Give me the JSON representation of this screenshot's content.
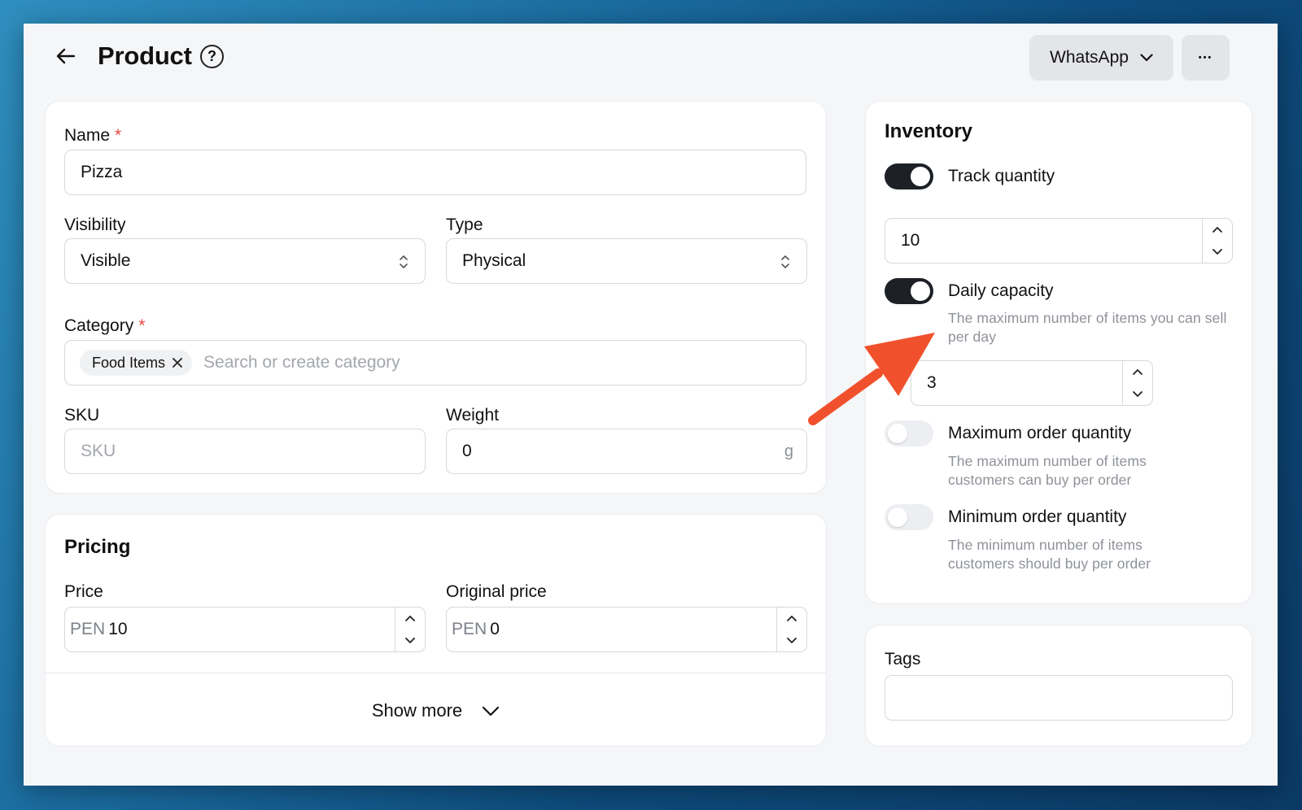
{
  "header": {
    "title": "Product",
    "help_glyph": "?",
    "channel_label": "WhatsApp",
    "more_glyph": "•••"
  },
  "details": {
    "name_label": "Name",
    "required_mark": "*",
    "name_value": "Pizza",
    "visibility_label": "Visibility",
    "visibility_value": "Visible",
    "type_label": "Type",
    "type_value": "Physical",
    "category_label": "Category",
    "category_chip": "Food Items",
    "category_placeholder": "Search or create category",
    "sku_label": "SKU",
    "sku_placeholder": "SKU",
    "weight_label": "Weight",
    "weight_value": "0",
    "weight_unit": "g"
  },
  "pricing": {
    "title": "Pricing",
    "price_label": "Price",
    "currency": "PEN",
    "price_value": "10",
    "original_price_label": "Original price",
    "original_price_value": "0",
    "show_more_label": "Show more"
  },
  "inventory": {
    "title": "Inventory",
    "track_quantity_label": "Track quantity",
    "track_quantity_on": true,
    "quantity_value": "10",
    "daily_capacity_label": "Daily capacity",
    "daily_capacity_on": true,
    "daily_capacity_help": "The maximum number of items you can sell per day",
    "daily_capacity_value": "3",
    "max_order_label": "Maximum order quantity",
    "max_order_on": false,
    "max_order_help": "The maximum number of items customers can buy per order",
    "min_order_label": "Minimum order quantity",
    "min_order_on": false,
    "min_order_help": "The minimum number of items customers should buy per order"
  },
  "tags": {
    "title": "Tags",
    "value": ""
  },
  "colors": {
    "annotation_arrow": "#f0512c",
    "toggle_on": "#1d2126",
    "required": "#e5483b"
  }
}
